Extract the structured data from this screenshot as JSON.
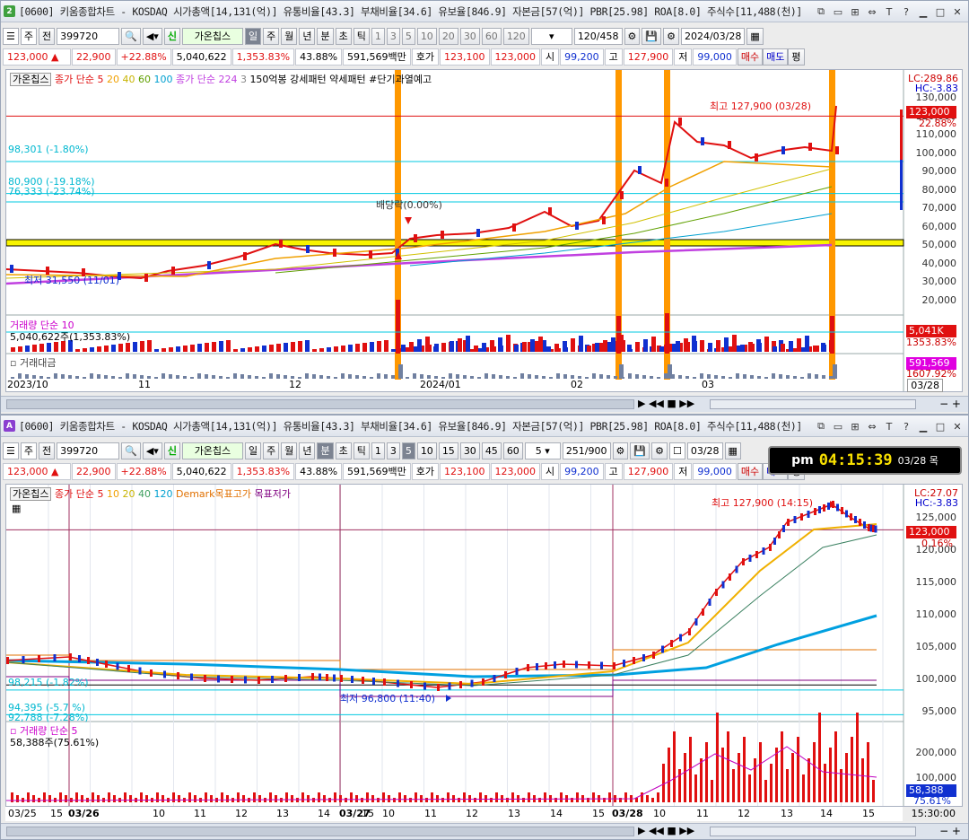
{
  "window1": {
    "badge": "2",
    "title": "[0600] 키움종합차트 - KOSDAQ 시가총액[14,131(억)] 유통비율[43.3] 부채비율[34.6] 유보율[846.9] 자본금[57(억)] PBR[25.98] ROA[8.0] 주식수[11,488(천)]"
  },
  "window2": {
    "badge": "A",
    "title": "[0600] 키움종합차트 - KOSDAQ 시가총액[14,131(억)] 유통비율[43.3] 부채비율[34.6] 유보율[846.9] 자본금[57(억)] PBR[25.98] ROA[8.0] 주식수[11,488(천)]"
  },
  "toolbar1": {
    "code": "399720",
    "market": "주",
    "prev": "전",
    "name": "가온칩스",
    "new": "신",
    "periods": [
      "일",
      "주",
      "월",
      "년",
      "분",
      "초",
      "틱"
    ],
    "nums": [
      "1",
      "3",
      "5",
      "10",
      "20",
      "30",
      "60",
      "120"
    ],
    "count": "120/458",
    "date": "2024/03/28"
  },
  "toolbar2": {
    "code": "399720",
    "market": "주",
    "prev": "전",
    "name": "가온칩스",
    "new": "신",
    "periods": [
      "일",
      "주",
      "월",
      "년",
      "분",
      "초",
      "틱"
    ],
    "nums": [
      "1",
      "3",
      "5",
      "10",
      "15",
      "30",
      "45",
      "60"
    ],
    "interval": "5",
    "count": "251/900",
    "date": "03/28"
  },
  "quote": {
    "price": "123,000",
    "sign": "▲",
    "change": "22,900",
    "pct": "+22.88%",
    "volume": "5,040,622",
    "vol_pct": "1,353.83%",
    "turnover": "43.88%",
    "amount": "591,569백만",
    "hoga_lbl": "호가",
    "bid": "123,100",
    "ask": "123,000",
    "open_lbl": "시",
    "open": "99,200",
    "high_lbl": "고",
    "high": "127,900",
    "low_lbl": "저",
    "low": "99,000",
    "buy": "매수",
    "sell": "매도",
    "avg": "평"
  },
  "clock": {
    "ampm": "pm",
    "time": "04:15:39",
    "date": "03/28 목"
  },
  "chart1": {
    "legend": {
      "name": "가온칩스",
      "ma1": "종가 단순 5",
      "ma_periods": [
        "20",
        "40",
        "60",
        "100"
      ],
      "ma2": "종가 단순 224",
      "ma2b": "3",
      "txt1": "150억봉 강세패턴",
      "txt2": "약세패턴",
      "txt3": "#단기과열예고"
    },
    "yaxis": [
      "130,000",
      "120,000",
      "110,000",
      "100,000",
      "90,000",
      "80,000",
      "70,000",
      "60,000",
      "50,000",
      "40,000",
      "30,000",
      "20,000"
    ],
    "lc": "LC:289.86",
    "hc": "HC:-3.83",
    "cur_tag": "123,000",
    "cur_pct": "22.88%",
    "high_note": "최고 127,900 (03/28)",
    "low_note": "최저 31,550 (11/01)",
    "fib1": "98,301 (-1.80%)",
    "fib2": "80,900 (-19.18%)",
    "fib3": "76,333 (-23.74%)",
    "div_note": "배당락(0.00%)",
    "vol_legend": "거래량 단순 10",
    "vol_value": "5,040,622주(1,353.83%)",
    "vol_tag": "5,041K",
    "vol_tag_pct": "1353.83%",
    "amt_legend": "거래대금",
    "amt_tag": "591,569",
    "amt_tag_pct": "1607.92%",
    "xaxis": [
      "2023/10",
      "11",
      "12",
      "2024/01",
      "02",
      "03"
    ],
    "xaxis_last": "03/28"
  },
  "chart2": {
    "legend": {
      "name": "가온칩스",
      "ma1": "종가 단순 5",
      "ma_periods": [
        "10",
        "20",
        "40",
        "120"
      ],
      "demark": "Demark목표고가",
      "demark2": "목표저가"
    },
    "yaxis": [
      "125,000",
      "120,000",
      "115,000",
      "110,000",
      "105,000",
      "100,000",
      "95,000"
    ],
    "lc": "LC:27.07",
    "hc": "HC:-3.83",
    "cur_tag": "123,000",
    "cur_pct": "0.16%",
    "high_note": "최고 127,900 (14:15)",
    "low_note": "최저 96,800 (11:40)",
    "fib1": "98,215 (-1.82%)",
    "fib2": "94,395 (-5.7 %)",
    "fib3": "92,788 (-7.28%)",
    "vol_legend": "거래량 단순 5",
    "vol_value": "58,388주(75.61%)",
    "vol_axis": [
      "200,000",
      "100,000"
    ],
    "vol_tag": "58,388",
    "vol_tag_pct": "75.61%",
    "xaxis": [
      "03/25",
      "15",
      "03/26",
      "10",
      "11",
      "12",
      "13",
      "14",
      "15",
      "03/27",
      "10",
      "11",
      "12",
      "13",
      "14",
      "15",
      "03/28",
      "10",
      "11",
      "12",
      "13",
      "14",
      "15"
    ],
    "xaxis_last": "15:30:00"
  },
  "colors": {
    "up": "#e01010",
    "down": "#1030d0",
    "fib": "#00c8e0",
    "ma5": "#e01010",
    "ma20": "#f0a000",
    "ma_purple": "#c040e0",
    "highlight": "#f8f400",
    "orange_bar": "#ff9800"
  }
}
